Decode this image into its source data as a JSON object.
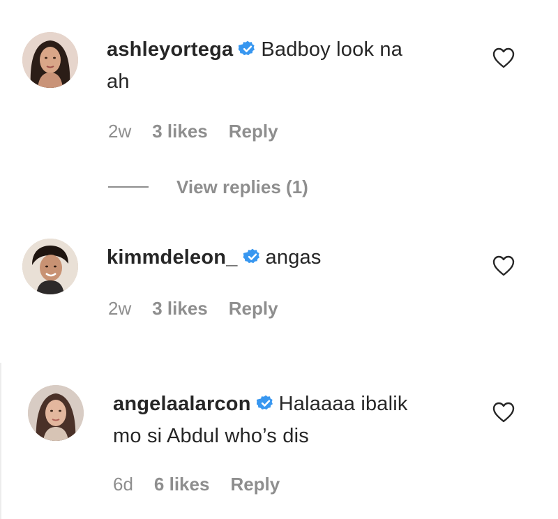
{
  "comments": [
    {
      "username": "ashleyortega",
      "text_line1": "Badboy look na",
      "text_line2": "ah",
      "time": "2w",
      "likes": "3 likes",
      "reply": "Reply",
      "verified_icon": "verified-badge-icon",
      "like_icon": "heart-outline-icon"
    },
    {
      "username": "kimmdeleon_",
      "text_line1": "angas",
      "time": "2w",
      "likes": "3 likes",
      "reply": "Reply",
      "verified_icon": "verified-badge-icon",
      "like_icon": "heart-outline-icon"
    },
    {
      "username": "angelaalarcon",
      "text_line1": "Halaaaa ibalik",
      "text_line2": "mo si Abdul who’s dis",
      "time": "6d",
      "likes": "6 likes",
      "reply": "Reply",
      "verified_icon": "verified-badge-icon",
      "like_icon": "heart-outline-icon"
    }
  ],
  "view_replies": "View replies (1)",
  "colors": {
    "text": "#262626",
    "secondary": "#8e8e8e",
    "verified": "#3897f0"
  }
}
